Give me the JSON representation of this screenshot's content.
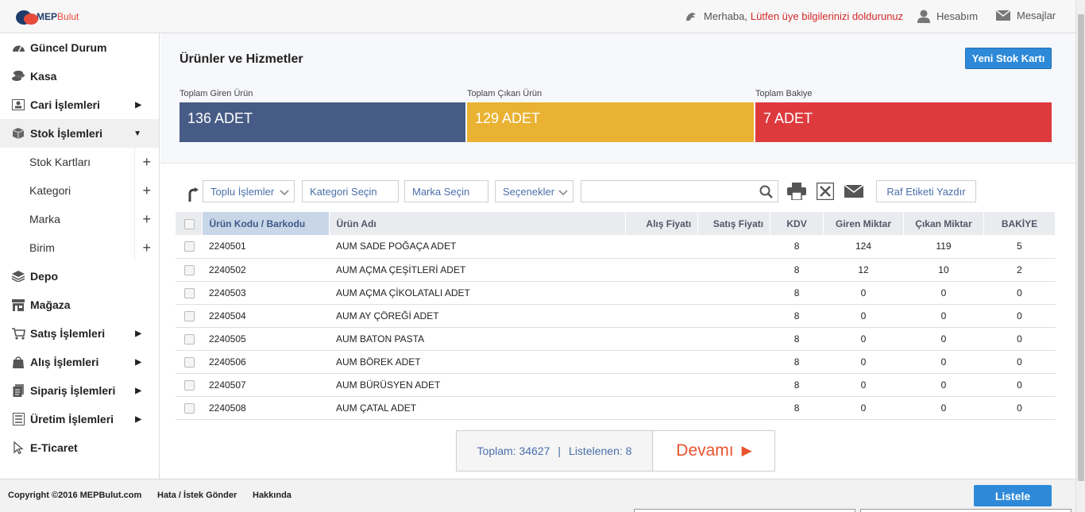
{
  "header": {
    "logo_text": "MEP",
    "logo_text_b": "Bulut",
    "greeting": "Merhaba,",
    "greeting_warning": "Lütfen üye bilgilerinizi doldurunuz",
    "account_label": "Hesabım",
    "messages_label": "Mesajlar"
  },
  "sidebar": {
    "items": [
      {
        "label": "Güncel Durum",
        "icon": "dashboard-icon"
      },
      {
        "label": "Kasa",
        "icon": "coins-icon"
      },
      {
        "label": "Cari İşlemleri",
        "icon": "contact-card-icon",
        "arrow": "▶"
      },
      {
        "label": "Stok İşlemleri",
        "icon": "box-icon",
        "arrow": "▼"
      },
      {
        "label": "Depo",
        "icon": "stack-icon"
      },
      {
        "label": "Mağaza",
        "icon": "store-icon"
      },
      {
        "label": "Satış İşlemleri",
        "icon": "cart-icon",
        "arrow": "▶"
      },
      {
        "label": "Alış İşlemleri",
        "icon": "bag-icon",
        "arrow": "▶"
      },
      {
        "label": "Sipariş İşlemleri",
        "icon": "documents-icon",
        "arrow": "▶"
      },
      {
        "label": "Üretim İşlemleri",
        "icon": "checklist-icon",
        "arrow": "▶"
      },
      {
        "label": "E-Ticaret",
        "icon": "cursor-icon"
      }
    ],
    "subitems": [
      {
        "label": "Stok Kartları",
        "plus": "+"
      },
      {
        "label": "Kategori",
        "plus": "+"
      },
      {
        "label": "Marka",
        "plus": "+"
      },
      {
        "label": "Birim",
        "plus": "+"
      }
    ]
  },
  "main": {
    "title": "Ürünler ve Hizmetler",
    "new_button": "Yeni Stok Kartı",
    "stats": [
      {
        "label": "Toplam Giren Ürün",
        "value": "136 ADET",
        "color": "#465b85"
      },
      {
        "label": "Toplam Çıkan Ürün",
        "value": "129 ADET",
        "color": "#eab232"
      },
      {
        "label": "Toplam Bakiye",
        "value": "7 ADET",
        "color": "#de3a3e"
      }
    ]
  },
  "toolbar": {
    "bulk": "Toplu İşlemler",
    "category": "Kategori Seçin",
    "brand": "Marka Seçin",
    "options": "Seçenekler",
    "search_value": "",
    "raf_label": "Raf Etiketi Yazdır"
  },
  "table": {
    "headers": {
      "code": "Ürün Kodu / Barkodu",
      "name": "Ürün Adı",
      "buy": "Alış Fiyatı",
      "sell": "Satış Fiyatı",
      "kdv": "KDV",
      "in": "Giren Miktar",
      "out": "Çıkan Miktar",
      "balance": "BAKİYE"
    },
    "rows": [
      {
        "code": "2240501",
        "name": "AUM SADE POĞAÇA ADET",
        "buy": "",
        "sell": "",
        "kdv": "8",
        "in": "124",
        "out": "119",
        "balance": "5"
      },
      {
        "code": "2240502",
        "name": "AUM AÇMA ÇEŞİTLERİ ADET",
        "buy": "",
        "sell": "",
        "kdv": "8",
        "in": "12",
        "out": "10",
        "balance": "2"
      },
      {
        "code": "2240503",
        "name": "AUM AÇMA ÇİKOLATALI ADET",
        "buy": "",
        "sell": "",
        "kdv": "8",
        "in": "0",
        "out": "0",
        "balance": "0"
      },
      {
        "code": "2240504",
        "name": "AUM AY ÇÖREĞİ ADET",
        "buy": "",
        "sell": "",
        "kdv": "8",
        "in": "0",
        "out": "0",
        "balance": "0"
      },
      {
        "code": "2240505",
        "name": "AUM BATON PASTA",
        "buy": "",
        "sell": "",
        "kdv": "8",
        "in": "0",
        "out": "0",
        "balance": "0"
      },
      {
        "code": "2240506",
        "name": "AUM BÖREK ADET",
        "buy": "",
        "sell": "",
        "kdv": "8",
        "in": "0",
        "out": "0",
        "balance": "0"
      },
      {
        "code": "2240507",
        "name": "AUM BÜRÜSYEN ADET",
        "buy": "",
        "sell": "",
        "kdv": "8",
        "in": "0",
        "out": "0",
        "balance": "0"
      },
      {
        "code": "2240508",
        "name": "AUM ÇATAL ADET",
        "buy": "",
        "sell": "",
        "kdv": "8",
        "in": "0",
        "out": "0",
        "balance": "0"
      }
    ]
  },
  "pager": {
    "total": "Toplam: 34627",
    "separator": "|",
    "listed": "Listelenen: 8",
    "more": "Devamı",
    "more_arrow": "▶"
  },
  "footer": {
    "copyright": "Copyright ©2016 MEPBulut.com",
    "feedback": "Hata / İstek Gönder",
    "about": "Hakkında",
    "list_button": "Listele"
  }
}
